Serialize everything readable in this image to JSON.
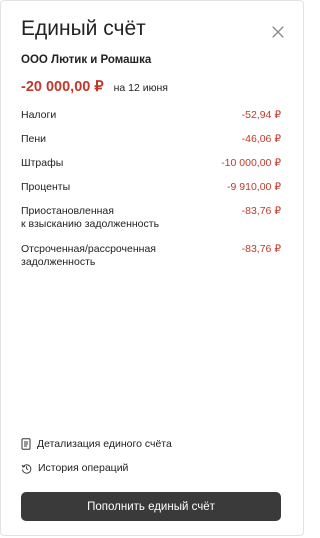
{
  "header": {
    "title": "Единый счёт"
  },
  "company": "ООО Лютик и Ромашка",
  "summary": {
    "total": "-20 000,00 ₽",
    "date": "на 12 июня"
  },
  "items": [
    {
      "label": "Налоги",
      "value": "-52,94 ₽"
    },
    {
      "label": "Пени",
      "value": "-46,06 ₽"
    },
    {
      "label": "Штрафы",
      "value": "-10 000,00 ₽"
    },
    {
      "label": "Проценты",
      "value": "-9 910,00 ₽"
    },
    {
      "label": "Приостановленная\nк взысканию задолженность",
      "value": "-83,76 ₽"
    },
    {
      "label": "Отсроченная/рассроченная\nзадолженность",
      "value": "-83,76 ₽"
    }
  ],
  "links": {
    "details": "Детализация единого счёта",
    "history": "История операций"
  },
  "actions": {
    "top_up": "Пополнить единый счёт"
  },
  "colors": {
    "negative": "#c0392b",
    "button": "#3a3a3a"
  },
  "icons": {
    "close": "close-icon",
    "details": "document-icon",
    "history": "history-icon"
  }
}
